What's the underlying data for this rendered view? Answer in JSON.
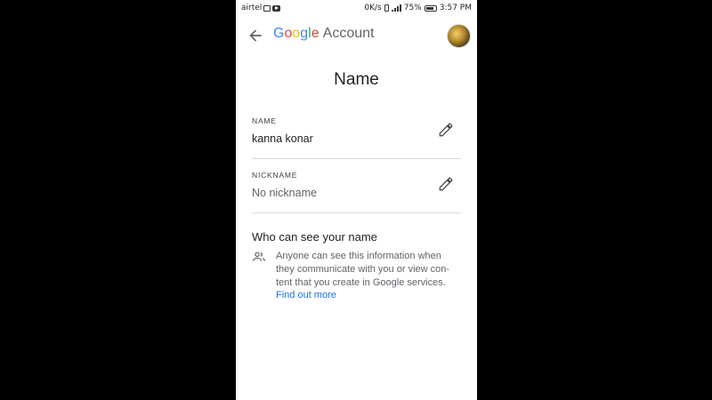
{
  "status_bar": {
    "carrier": "airtel",
    "network_speed": "0K/s",
    "battery_percent": "75%",
    "time": "3:57 PM"
  },
  "header": {
    "logo": [
      "G",
      "o",
      "o",
      "g",
      "l",
      "e"
    ],
    "account_word": "Account",
    "avatar_icon": "user-avatar"
  },
  "page": {
    "title": "Name"
  },
  "name_field": {
    "label": "NAME",
    "value": "kanna konar",
    "edit_icon": "pencil-icon"
  },
  "nickname_field": {
    "label": "NICKNAME",
    "value": "No nickname",
    "edit_icon": "pencil-icon"
  },
  "visibility": {
    "title": "Who can see your name",
    "icon": "people-icon",
    "line1": "Anyone can see this information when",
    "line2": "they communicate with you or view con-",
    "line3": "tent that you create in Google services.",
    "link": "Find out more"
  },
  "colors": {
    "google_blue": "#4285F4",
    "google_red": "#EA4335",
    "google_yellow": "#FBBC05",
    "google_green": "#34A853",
    "link_blue": "#1a73e8"
  }
}
